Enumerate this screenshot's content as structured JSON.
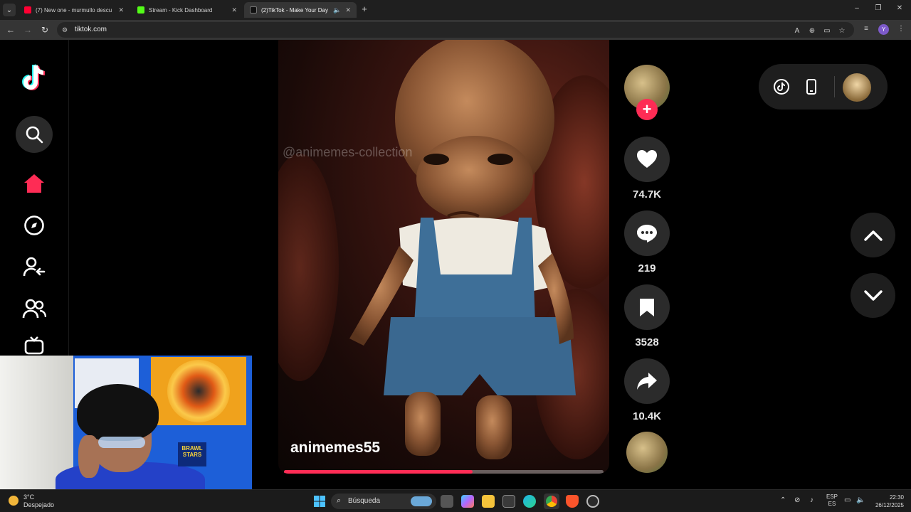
{
  "browser": {
    "tabs": [
      {
        "title": "(7) New one - murmullo descu",
        "favicon_color": "#ff0033",
        "active": false
      },
      {
        "title": "Stream - Kick Dashboard",
        "favicon_color": "#53fc18",
        "active": false
      },
      {
        "title": "(2)TikTok - Make Your Day",
        "favicon_color": "#111111",
        "active": true
      }
    ],
    "new_tab": "+",
    "url": "tiktok.com",
    "profile_initial": "Y"
  },
  "tiktok": {
    "video": {
      "watermark": "@animemes-collection",
      "author": "animemes55",
      "progress": 0.59
    },
    "actions": {
      "like_count": "74.7K",
      "comment_count": "219",
      "bookmark_count": "3528",
      "share_count": "10.4K"
    },
    "accent": "#fe2c55"
  },
  "webcam": {
    "poster_text": "BRAWL STARS"
  },
  "taskbar": {
    "weather_temp": "3°C",
    "weather_text": "Despejado",
    "search_label": "Búsqueda",
    "lang_top": "ESP",
    "lang_bottom": "ES",
    "time": "22:30",
    "date": "26/12/2025"
  }
}
